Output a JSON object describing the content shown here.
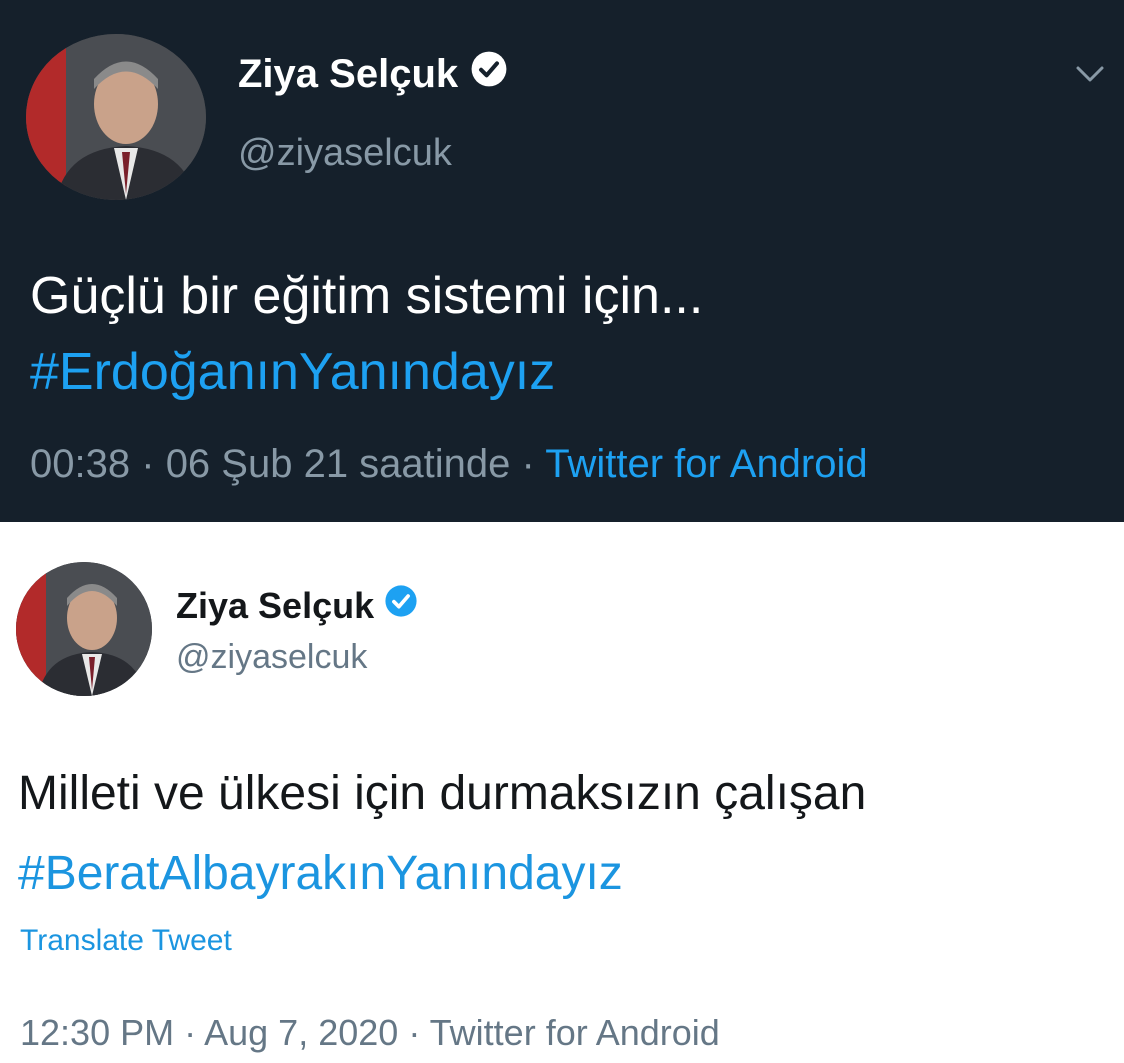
{
  "tweets": [
    {
      "theme": "dark",
      "name": "Ziya Selçuk",
      "handle": "@ziyaselcuk",
      "text": "Güçlü bir eğitim sistemi için...",
      "hashtag": "#ErdoğanınYanındayız",
      "time": "00:38",
      "separator": "·",
      "date": "06 Şub 21 saatinde",
      "source": "Twitter for Android",
      "icons": {
        "verified": "verified-badge-icon",
        "menu": "chevron-down-icon"
      }
    },
    {
      "theme": "light",
      "name": "Ziya Selçuk",
      "handle": "@ziyaselcuk",
      "text": "Milleti ve ülkesi için durmaksızın çalışan",
      "hashtag": "#BeratAlbayrakınYanındayız",
      "translate": "Translate Tweet",
      "time": "12:30 PM",
      "separator": "·",
      "date": "Aug 7, 2020",
      "source": "Twitter for Android",
      "icons": {
        "verified": "verified-badge-icon"
      }
    }
  ],
  "colors": {
    "dark_bg": "#15202b",
    "link_blue": "#1da1f2",
    "muted_dark": "#8899a6",
    "muted_light": "#657786"
  }
}
